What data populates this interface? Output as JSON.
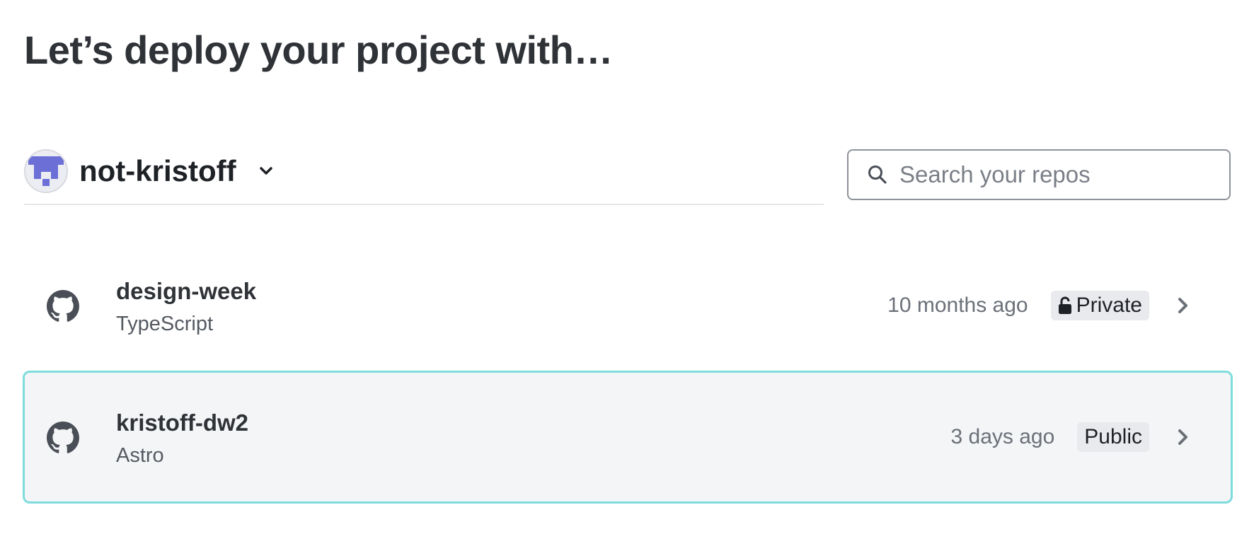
{
  "page": {
    "title": "Let’s deploy your project with…"
  },
  "account": {
    "name": "not-kristoff",
    "avatar_icon": "avatar-identicon",
    "dropdown_icon": "chevron-down-icon",
    "avatar_accent": "#6b6fd6"
  },
  "search": {
    "placeholder": "Search your repos",
    "value": "",
    "icon": "search-icon"
  },
  "repos": [
    {
      "name": "design-week",
      "language": "TypeScript",
      "updated": "10 months ago",
      "visibility": "Private",
      "locked": true,
      "icon": "github-icon",
      "selected": false
    },
    {
      "name": "kristoff-dw2",
      "language": "Astro",
      "updated": "3 days ago",
      "visibility": "Public",
      "locked": false,
      "icon": "github-icon",
      "selected": true
    }
  ],
  "colors": {
    "selected_border": "#7fdcdc",
    "selected_background": "#f4f5f7",
    "badge_background": "#e9eaed"
  }
}
